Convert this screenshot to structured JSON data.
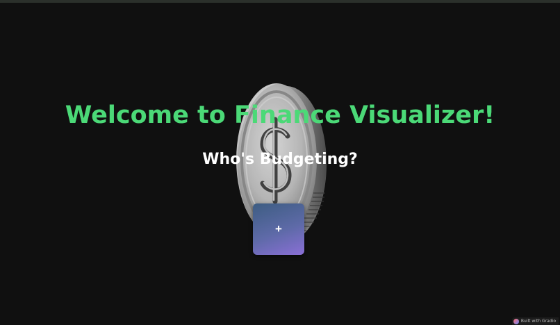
{
  "page": {
    "title": "Welcome to Finance Visualizer!",
    "subtitle": "Who's Budgeting?"
  },
  "add_profile": {
    "label": "+"
  },
  "badge": {
    "text": "Built with Gradio",
    "icon": "gradio-logo-icon"
  },
  "colors": {
    "background": "#101010",
    "title": "#4bd977",
    "subtitle": "#ffffff",
    "button_gradient_start": "#3d5d82",
    "button_gradient_end": "#8a6fd6"
  },
  "decoration": {
    "icon": "dollar-coin-icon"
  }
}
